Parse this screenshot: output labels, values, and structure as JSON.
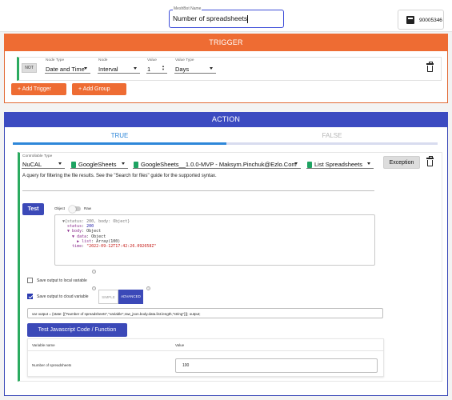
{
  "header": {
    "meshbot_name_label": "MeshBot Name",
    "meshbot_name_value": "Number of spreadsheets",
    "device_id": "90005346"
  },
  "trigger": {
    "title": "TRIGGER",
    "not_label": "NOT",
    "node_type_label": "Node Type",
    "node_type_value": "Date and Time",
    "node_label": "Node",
    "node_value": "Interval",
    "value_label": "Value",
    "value_value": "1",
    "value_type_label": "Value Type",
    "value_type_value": "Days",
    "add_trigger": "Add Trigger",
    "add_group": "Add Group"
  },
  "action": {
    "title": "ACTION",
    "tab_true": "TRUE",
    "tab_false": "FALSE",
    "controllable_type_label": "Controllable Type",
    "controllable_type_value": "NuCAL",
    "service_value": "GoogleSheets",
    "account_value": "GoogleSheets__1.0.0-MVP - Maksym.Pinchuk@Ezlo.Com",
    "method_value": "List Spreadsheets",
    "exception_label": "Exception",
    "description": "A query for filtering the file results. See the \"Search for files\" guide for the supported syntax.",
    "test_label": "Test",
    "toggle_object": "Object",
    "toggle_raw": "Raw",
    "json": {
      "root": "▼{status: 200, body: Object}",
      "status_key": "status",
      "status_val": "200",
      "body_key": "▼ body",
      "body_val": "Object",
      "data_key": "▼ data",
      "data_val": "Object",
      "list_key": "▶ list",
      "list_val": "Array(100)",
      "time_key": "time",
      "time_val": "\"2022-09-12T17:42:26.092658Z\""
    },
    "save_local_label": "Save output to local variable",
    "save_local_checked": false,
    "save_cloud_label": "Save output to cloud variable",
    "save_cloud_checked": true,
    "seg_simple": "SIMPLE",
    "seg_advanced": "ADVANCED",
    "code": "var output = {state: [{\"Number of spreadsheets\",\"variable\",raw_json.body.data.list.length,\"string\"}]}; output;",
    "test_js_label": "Test Javascript Code / Function",
    "table": {
      "col_variable": "Variable name",
      "col_value": "Value",
      "rows": [
        {
          "name": "Number of spreadsheets",
          "value": "100"
        }
      ]
    }
  },
  "colors": {
    "trigger_accent": "#ee6c33",
    "action_accent": "#3c4bc1",
    "tab_active": "#2e87d9",
    "row_marker": "#2bab60"
  }
}
